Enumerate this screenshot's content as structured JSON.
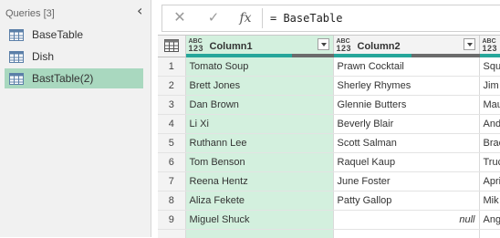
{
  "queries": {
    "header": "Queries [3]",
    "collapse_icon": "‹",
    "items": [
      {
        "label": "BaseTable",
        "icon": "table-icon",
        "selected": false
      },
      {
        "label": "Dish",
        "icon": "table-icon",
        "selected": false
      },
      {
        "label": "BastTable(2)",
        "icon": "table-icon",
        "selected": true
      }
    ]
  },
  "formula_bar": {
    "cancel_icon": "✕",
    "confirm_icon": "✓",
    "fx_label": "fx",
    "formula": "= BaseTable"
  },
  "grid": {
    "type_badge_top": "ABC",
    "type_badge_bottom": "123",
    "columns": [
      {
        "title": "Column1",
        "selected": true
      },
      {
        "title": "Column2",
        "selected": false
      },
      {
        "title": "Column3",
        "selected": false
      }
    ],
    "rows": [
      {
        "num": "1",
        "c1": "Tomato Soup",
        "c2": "Prawn Cocktail",
        "c3": "Squ"
      },
      {
        "num": "2",
        "c1": "Brett Jones",
        "c2": "Sherley Rhymes",
        "c3": "Jim"
      },
      {
        "num": "3",
        "c1": "Dan Brown",
        "c2": "Glennie Butters",
        "c3": "Mau"
      },
      {
        "num": "4",
        "c1": "Li Xi",
        "c2": "Beverly Blair",
        "c3": "And"
      },
      {
        "num": "5",
        "c1": "Ruthann Lee",
        "c2": "Scott Salman",
        "c3": "Brac"
      },
      {
        "num": "6",
        "c1": "Tom Benson",
        "c2": "Raquel Kaup",
        "c3": "Truc"
      },
      {
        "num": "7",
        "c1": "Reena Hentz",
        "c2": "June Foster",
        "c3": "Apri"
      },
      {
        "num": "8",
        "c1": "Aliza Fekete",
        "c2": "Patty Gallop",
        "c3": "Mik"
      },
      {
        "num": "9",
        "c1": "Miguel Shuck",
        "c2": "null",
        "c3": "Ang"
      }
    ],
    "colors": {
      "selected_column": "#d3f0de",
      "selected_query": "#a9d8bf",
      "quality_valid": "#26a69a",
      "quality_other": "#6b6b6b"
    }
  }
}
